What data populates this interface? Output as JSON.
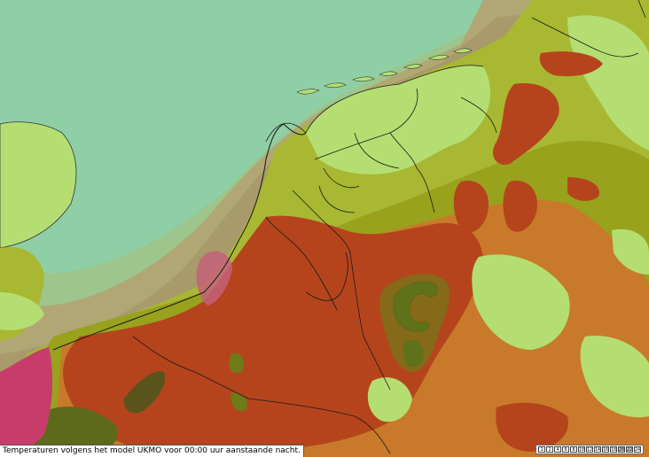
{
  "caption": "Temperaturen volgens het model UKMO voor 00:00 uur aanstaande nacht.",
  "legend": [
    {
      "label": "1",
      "color": "#ffffff"
    },
    {
      "label": "2",
      "color": "#ffffff"
    },
    {
      "label": "4",
      "color": "#ffffff"
    },
    {
      "label": "6",
      "color": "#ffffff"
    },
    {
      "label": "8",
      "color": "#ffffff"
    },
    {
      "label": "10",
      "color": "#ffffff"
    },
    {
      "label": "12",
      "color": "#ffffff"
    },
    {
      "label": "14",
      "color": "#ffffff"
    },
    {
      "label": "16",
      "color": "#ffffff"
    },
    {
      "label": "18",
      "color": "#ffffff"
    },
    {
      "label": "20",
      "color": "#c8c8c8"
    },
    {
      "label": "22",
      "color": "#c8c8c8"
    },
    {
      "label": "24",
      "color": "#ffffff"
    }
  ],
  "colors": {
    "sea": "#8fcfa6",
    "light_green": "#b4de72",
    "yellow_green": "#a8b832",
    "olive": "#99a21c",
    "orange_brown": "#c87a2a",
    "red_brown": "#b5441c",
    "dark_green": "#3b5a1c",
    "muted_brown": "#9c8f60",
    "pink": "#c63d6b"
  }
}
